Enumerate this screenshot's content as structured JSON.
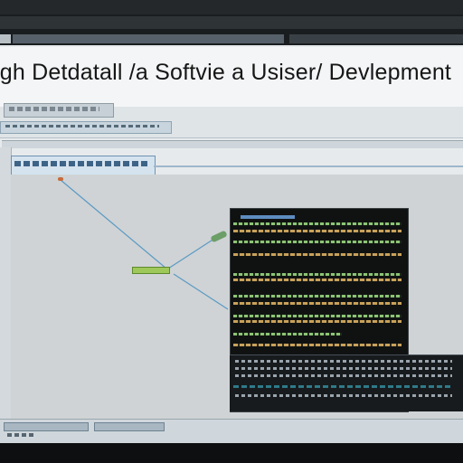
{
  "headline": "igh Detdatall /a Softvie a Usiser/ Devlepment",
  "colors": {
    "background": "#0d0f10",
    "window": "#e7eaec",
    "terminal_bg": "#101212",
    "terminal_orange": "#c9a15a",
    "terminal_green": "#8cc474",
    "connector": "#5b9ac4",
    "selection": "#d5e3ef"
  },
  "icons": [
    "pin-node-icon",
    "plug-node-icon",
    "junction-bar-icon"
  ]
}
